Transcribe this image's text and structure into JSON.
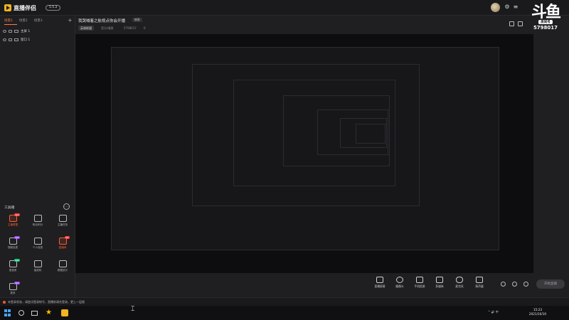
{
  "app": {
    "name": "直播伴侣",
    "version": "5.5.2"
  },
  "left_panel": {
    "tabs": [
      {
        "label": "场景1",
        "active": true
      },
      {
        "label": "场景2",
        "active": false
      },
      {
        "label": "场景3",
        "active": false
      }
    ],
    "sources": [
      {
        "label": "主屏 1"
      },
      {
        "label": "窗口 1"
      }
    ],
    "toolbox_title": "工具箱",
    "tools": [
      {
        "label": "主播联盟",
        "icon": "home-icon",
        "badge": "new",
        "badge_color": "red",
        "highlight": true
      },
      {
        "label": "粉丝积分",
        "icon": "gift-icon",
        "badge": "",
        "badge_color": "",
        "highlight": false
      },
      {
        "label": "主播任务",
        "icon": "task-icon",
        "badge": "",
        "badge_color": "",
        "highlight": false
      },
      {
        "label": "视频连麦",
        "icon": "link-icon",
        "badge": "new",
        "badge_color": "purple",
        "highlight": false
      },
      {
        "label": "个人信息",
        "icon": "user-icon",
        "badge": "",
        "badge_color": "",
        "highlight": false
      },
      {
        "label": "直播间",
        "icon": "live-icon",
        "badge": "hot",
        "badge_color": "red",
        "highlight": true
      },
      {
        "label": "语音房",
        "icon": "mic-icon",
        "badge": "new",
        "badge_color": "green",
        "highlight": false
      },
      {
        "label": "抽奖机",
        "icon": "lottery-icon",
        "badge": "",
        "badge_color": "",
        "highlight": false
      },
      {
        "label": "数据统计",
        "icon": "chart-icon",
        "badge": "",
        "badge_color": "",
        "highlight": false
      },
      {
        "label": "更多",
        "icon": "more-icon",
        "badge": "new",
        "badge_color": "purple",
        "highlight": false
      }
    ]
  },
  "header": {
    "stream_title": "我哭喊着之航视点你会开播",
    "edit_label": "修改",
    "category": "英雄联盟",
    "tag_text": "音乐/唱歌",
    "room_id": "5798017",
    "fans": "0"
  },
  "watermark": {
    "logo": "斗鱼",
    "sub": "房间号",
    "number": "5798017"
  },
  "controls": [
    {
      "label": "直播屏幕",
      "icon": "screen-icon"
    },
    {
      "label": "摄像头",
      "icon": "camera-icon"
    },
    {
      "label": "手机投屏",
      "icon": "phone-cast-icon"
    },
    {
      "label": "多媒体",
      "icon": "media-icon"
    },
    {
      "label": "麦克风",
      "icon": "microphone-icon"
    },
    {
      "label": "扬声器",
      "icon": "speaker-icon"
    }
  ],
  "start_button": "开始直播",
  "status": {
    "text": "未登录状态，请尝试登录帐号，直播前请先登录，更上一层楼"
  },
  "taskbar": {
    "time": "15:23",
    "date": "2021/10/10",
    "ime": "中",
    "tray_text": "^ 🔊 中"
  },
  "colors": {
    "accent": "#ff5a2c",
    "brand": "#f0b323",
    "background": "#1f1f22",
    "canvas": "#0d0d0f"
  }
}
